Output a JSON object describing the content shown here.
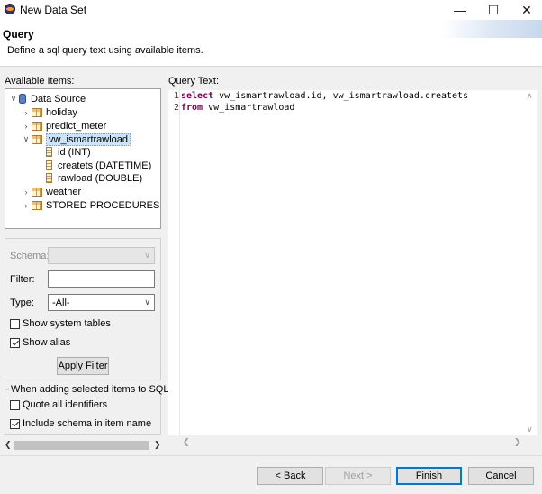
{
  "window": {
    "title": "New Data Set",
    "minimize": "—",
    "maximize": "☐",
    "close": "✕"
  },
  "header": {
    "title": "Query",
    "description": "Define a sql query text using available items."
  },
  "left": {
    "available_label": "Available Items:",
    "tree": [
      {
        "label": "Data Source",
        "expanded": true,
        "icon": "database-icon"
      },
      {
        "label": "holiday",
        "icon": "table-icon"
      },
      {
        "label": "predict_meter",
        "icon": "table-icon"
      },
      {
        "label": "vw_ismartrawload",
        "icon": "table-icon",
        "selected": true
      },
      {
        "label": "id (INT)",
        "icon": "column-icon"
      },
      {
        "label": "createts (DATETIME)",
        "icon": "column-icon"
      },
      {
        "label": "rawload (DOUBLE)",
        "icon": "column-icon"
      },
      {
        "label": "weather",
        "icon": "table-icon"
      },
      {
        "label": "STORED PROCEDURES",
        "icon": "table-icon"
      }
    ],
    "filter": {
      "schema_label": "Schema:",
      "schema_value": "",
      "filter_label": "Filter:",
      "filter_value": "",
      "type_label": "Type:",
      "type_value": "-All-",
      "show_system_tables": "Show system tables",
      "show_system_tables_checked": false,
      "show_alias": "Show alias",
      "show_alias_checked": true,
      "apply_button": "Apply Filter"
    },
    "sql_group": {
      "legend": "When adding selected items to SQL",
      "quote_all": "Quote all identifiers",
      "quote_all_checked": false,
      "include_schema": "Include schema in item name",
      "include_schema_checked": true
    }
  },
  "query": {
    "label": "Query Text:",
    "lines": [
      {
        "number": "1",
        "keyword": "select",
        "rest": " vw_ismartrawload.id, vw_ismartrawload.createts"
      },
      {
        "number": "2",
        "keyword": "from",
        "rest": " vw_ismartrawload"
      }
    ]
  },
  "footer": {
    "back": "< Back",
    "next": "Next >",
    "finish": "Finish",
    "cancel": "Cancel"
  }
}
